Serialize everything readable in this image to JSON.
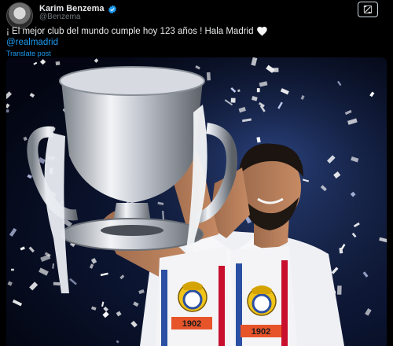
{
  "author": {
    "display_name": "Karim Benzema",
    "handle": "@Benzema",
    "avatar_icon": "avatar-photo",
    "verified_icon": "verified-badge-icon"
  },
  "post": {
    "text": "¡ El mejor club del mundo cumple hoy 123 años ! Hala Madrid",
    "emoji_icon": "white-heart-icon",
    "mention": "@realmadrid",
    "translate_label": "Translate post"
  },
  "toolbar": {
    "grok_icon": "grok-icon"
  },
  "media": {
    "scarf_year": "1902"
  },
  "colors": {
    "background": "#000000",
    "text": "#e7e9ea",
    "secondary_text": "#71767b",
    "link": "#1d9bf0",
    "verified": "#1d9bf0"
  }
}
